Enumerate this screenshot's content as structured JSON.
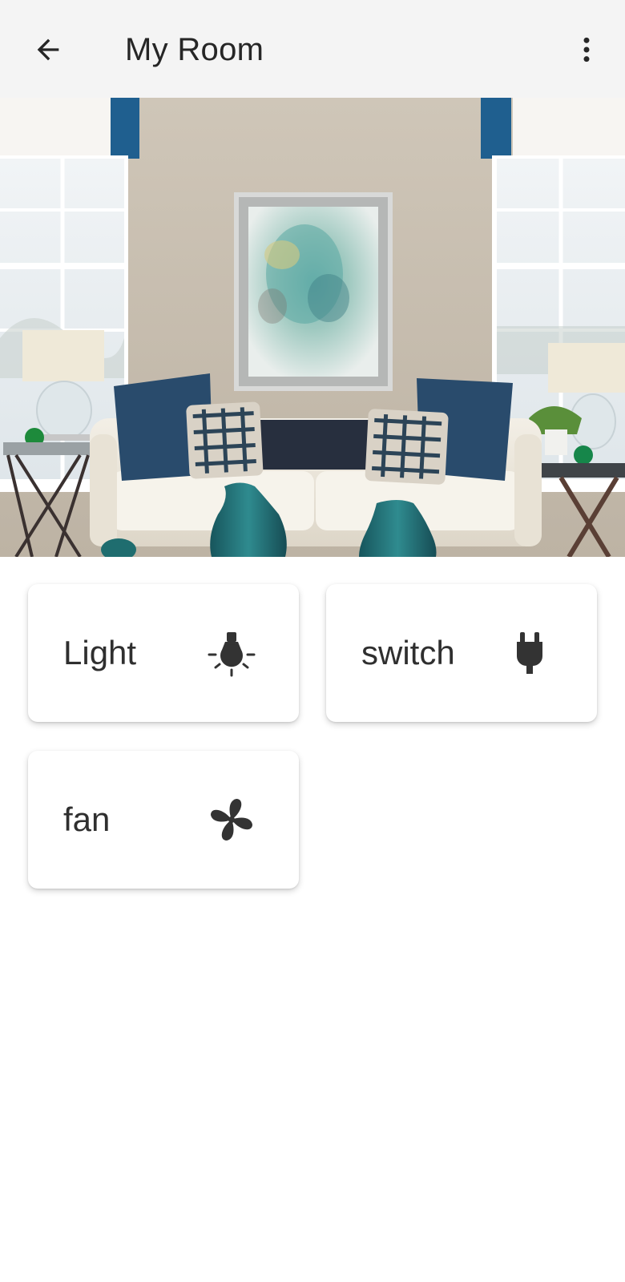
{
  "appbar": {
    "title": "My Room",
    "back_icon": "arrow-back-icon",
    "menu_icon": "more-vert-icon",
    "background": "#f4f4f4"
  },
  "hero": {
    "icon": "room-photo"
  },
  "devices": [
    {
      "label": "Light",
      "icon": "light-bulb-icon"
    },
    {
      "label": "switch",
      "icon": "power-plug-icon"
    },
    {
      "label": "fan",
      "icon": "fan-icon"
    }
  ],
  "colors": {
    "icon": "#333333",
    "text": "#2b2b2b",
    "card_background": "#ffffff"
  }
}
